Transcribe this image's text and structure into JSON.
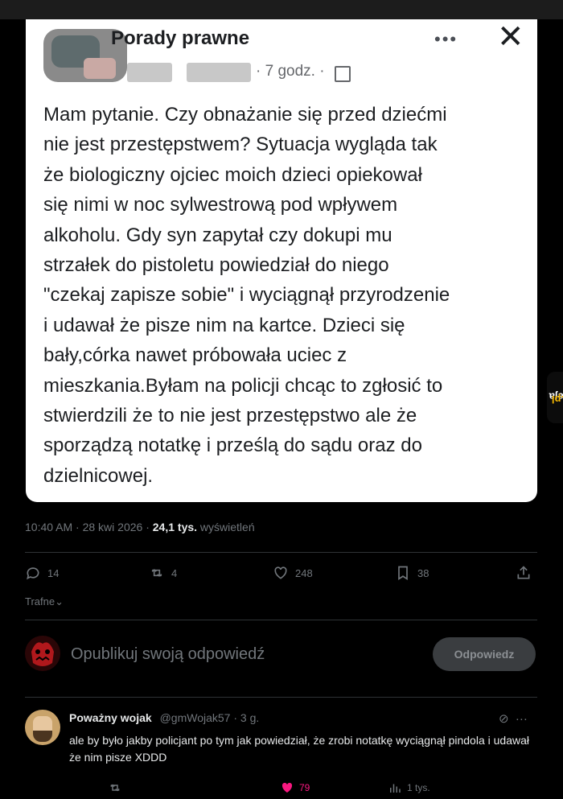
{
  "post": {
    "group_name": "Porady prawne",
    "time": "· 7 godz. ·",
    "more_icon": "more-horizontal-icon",
    "close_icon": "close-icon",
    "text": "Mam pytanie. Czy obnażanie się przed dziećmi\nnie jest przestępstwem? Sytuacja wygląda tak\nże biologiczny ojciec moich dzieci opiekował\nsię nimi  w noc sylwestrową pod wpływem\nalkoholu. Gdy syn zapytał czy dokupi mu\nstrzałek do pistoletu powiedział do niego\n\"czekaj zapisze sobie\" i wyciągnął przyrodzenie\ni udawał że pisze nim na kartce. Dzieci się\nbały,córka nawet próbowała uciec z\nmieszkania.Byłam na policji chcąc to zgłosić to\nstwierdzili że to nie jest przestępstwo ale że\nsporządzą notatkę i prześlą do sądu oraz do\ndzielnicowej."
  },
  "tweet": {
    "timestamp": "10:40 AM · 28 kwi 2026 ·",
    "views_count": "24,1 tys.",
    "views_label": "wyświetleń",
    "actions": {
      "replies": "14",
      "reposts": "4",
      "likes": "248",
      "bookmarks": "38"
    },
    "sort_label": "Trafne"
  },
  "compose": {
    "placeholder": "Opublikuj swoją odpowiedź",
    "button_label": "Odpowiedz"
  },
  "reply": {
    "name": "Poważny wojak",
    "handle": "@gmWojak57 · 3 g.",
    "text": "ale by było jakby policjant po tym jak powiedział, że zrobi notatkę wyciągnął pindola i udawał że nim pisze XDDD",
    "likes": "79",
    "views": "1 tys."
  },
  "watermark": {
    "text_main": "jeja",
    "text_dot": ".pl"
  },
  "colors": {
    "background": "#000000",
    "card": "#ffffff",
    "like_pink": "#f91880",
    "muted": "#71767b"
  }
}
